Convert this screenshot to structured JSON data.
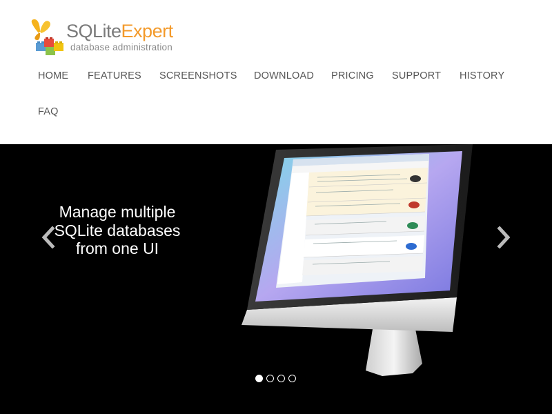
{
  "logo": {
    "name_part1": "SQLite",
    "name_part2": "Expert",
    "tagline": "database administration"
  },
  "nav": {
    "items": [
      "HOME",
      "FEATURES",
      "SCREENSHOTS",
      "DOWNLOAD",
      "PRICING",
      "SUPPORT",
      "HISTORY",
      "FAQ"
    ]
  },
  "hero": {
    "caption_lines": [
      "Manage multiple",
      "SQLite databases",
      "from one UI"
    ],
    "slides": 4,
    "active_slide": 1
  },
  "colors": {
    "brand_orange": "#f39a2b",
    "brand_gray": "#7a7a7a",
    "nav_text": "#555555",
    "hero_bg": "#000000"
  }
}
